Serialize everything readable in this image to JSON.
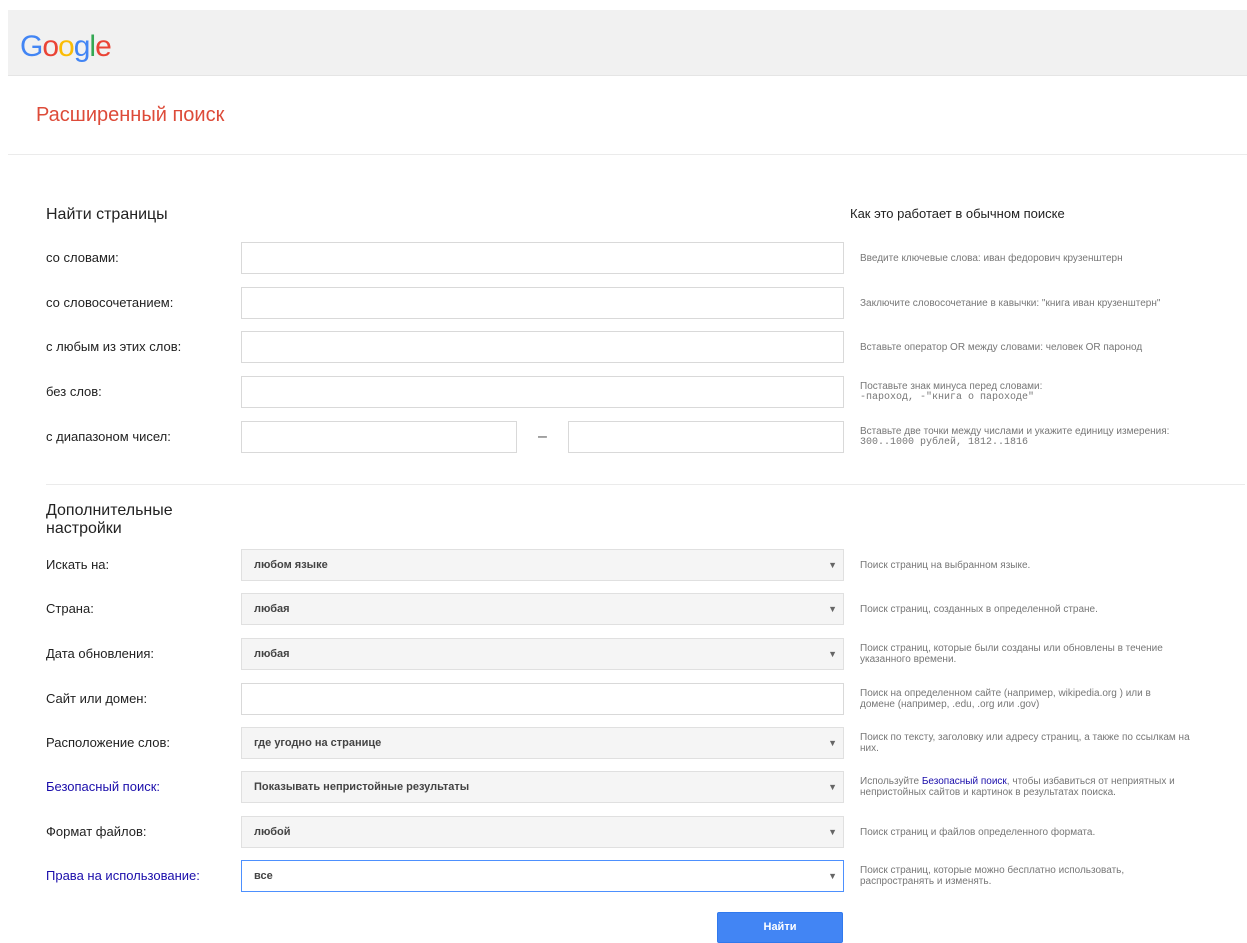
{
  "header": {
    "logo_letters": [
      {
        "char": "G",
        "color": "#4285f4"
      },
      {
        "char": "o",
        "color": "#ea4335"
      },
      {
        "char": "o",
        "color": "#fbbc05"
      },
      {
        "char": "g",
        "color": "#4285f4"
      },
      {
        "char": "l",
        "color": "#34a853"
      },
      {
        "char": "e",
        "color": "#ea4335"
      }
    ]
  },
  "page_title": "Расширенный поиск",
  "find_pages": {
    "title": "Найти страницы",
    "how_title": "Как это работает в обычном поиске",
    "rows": [
      {
        "label": "со словами:",
        "value": "",
        "hint": "Введите ключевые слова: иван федорович крузенштерн"
      },
      {
        "label": "со словосочетанием:",
        "value": "",
        "hint": "Заключите словосочетание в кавычки: \"книга иван крузенштерн\""
      },
      {
        "label": "с любым из этих слов:",
        "value": "",
        "hint": "Вставьте оператор OR между словами: человек OR паронод"
      },
      {
        "label": "без слов:",
        "value": "",
        "hint_line1": "Поставьте знак минуса перед словами:",
        "hint_line2": "-пароход, -\"книга о пароходе\""
      },
      {
        "label": "с диапазоном чисел:",
        "from": "",
        "to": "",
        "separator": "–",
        "hint_line1": "Вставьте две точки между числами и укажите единицу измерения:",
        "hint_line2": "300..1000 рублей, 1812..1816"
      }
    ]
  },
  "advanced": {
    "title_line1": "Дополнительные",
    "title_line2": "настройки",
    "rows": [
      {
        "label": "Искать на:",
        "value": "любом языке",
        "hint": "Поиск страниц на выбранном языке."
      },
      {
        "label": "Страна:",
        "value": "любая",
        "hint": "Поиск страниц, созданных в определенной стране."
      },
      {
        "label": "Дата обновления:",
        "value": "любая",
        "hint_line1": "Поиск страниц, которые были созданы или обновлены в течение",
        "hint_line2": "указанного времени."
      },
      {
        "label": "Сайт или домен:",
        "value": "",
        "hint_line1": "Поиск на определенном сайте (например, wikipedia.org ) или в",
        "hint_line2": "домене (например, .edu, .org или .gov)"
      },
      {
        "label": "Расположение слов:",
        "value": "где угодно на странице",
        "hint_line1": "Поиск по тексту, заголовку или адресу страниц, а также по ссылкам на",
        "hint_line2": "них."
      },
      {
        "label": "Безопасный поиск:",
        "value": "Показывать непристойные результаты",
        "hint_pre": "Используйте ",
        "hint_link": "Безопасный поиск",
        "hint_post": ", чтобы избавиться от неприятных и",
        "hint_line2": "непристойных сайтов и картинок в результатах поиска."
      },
      {
        "label": "Формат файлов:",
        "value": "любой",
        "hint": "Поиск страниц и файлов определенного формата."
      },
      {
        "label": "Права на использование:",
        "value": "все",
        "hint_line1": "Поиск страниц, которые можно бесплатно использовать,",
        "hint_line2": "распространять и изменять."
      }
    ]
  },
  "search_button": "Найти",
  "colors": {
    "title_red": "#dd4b39",
    "link_blue": "#1a0dab",
    "button_blue": "#4285f4",
    "focus_blue": "#4d90fe"
  },
  "icons": {
    "dropdown": "chevron-down-icon"
  }
}
